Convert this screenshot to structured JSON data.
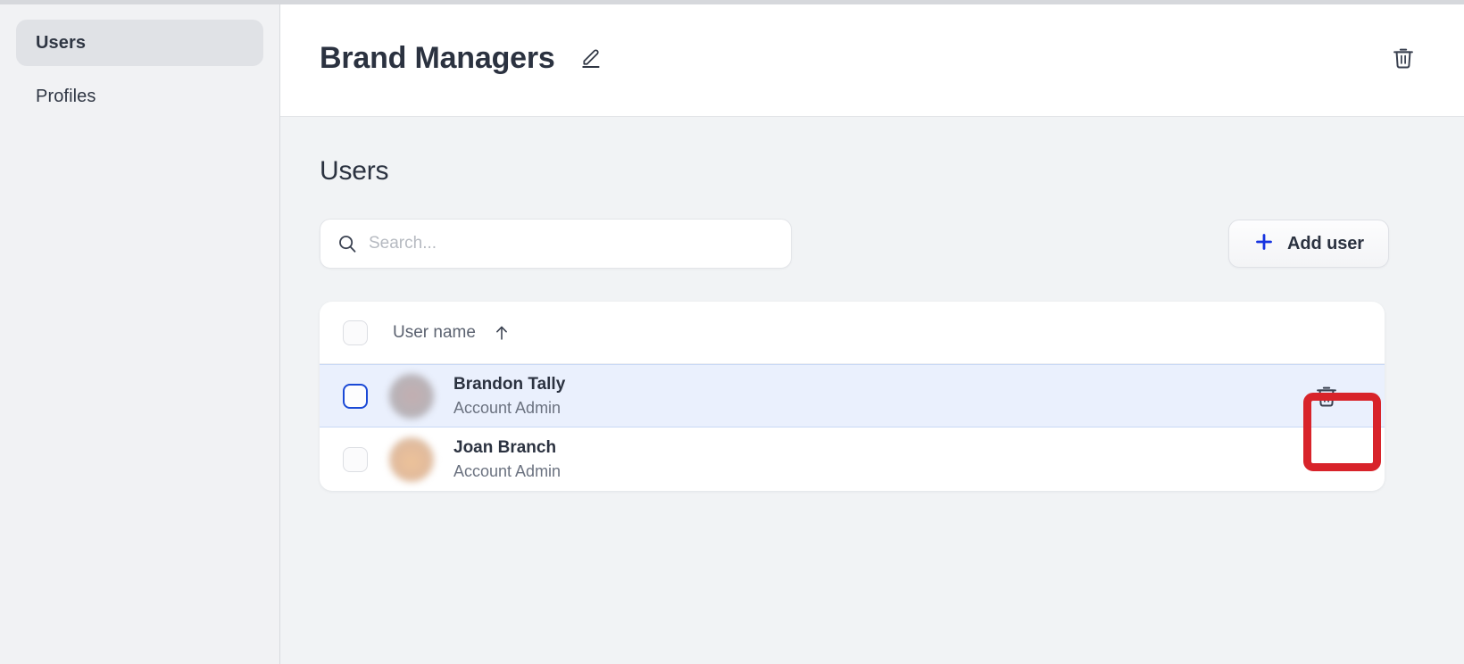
{
  "theme": {
    "accent_blue": "#1a49d6",
    "text_dark": "#2b3240",
    "text_muted": "#6b7280",
    "sidebar_bg": "#f1f2f4",
    "content_bg": "#f1f3f5",
    "selected_row_bg": "#eaf0fd",
    "annotation_red": "#d8232a"
  },
  "sidebar": {
    "items": [
      {
        "label": "Users",
        "active": true
      },
      {
        "label": "Profiles",
        "active": false
      }
    ]
  },
  "header": {
    "title": "Brand Managers",
    "edit_icon": "pencil-icon",
    "delete_icon": "trash-icon"
  },
  "main": {
    "section_title": "Users",
    "search": {
      "placeholder": "Search...",
      "value": "",
      "icon": "search-icon"
    },
    "add_user": {
      "label": "Add user",
      "icon": "plus-icon"
    },
    "table": {
      "columns": [
        {
          "label": "User name",
          "sort": "ascending",
          "sort_icon": "arrow-up-icon"
        }
      ],
      "select_all_checked": false,
      "rows": [
        {
          "name": "Brandon Tally",
          "role": "Account Admin",
          "checked": false,
          "selected": true,
          "avatar": "avatar-blurred-gray",
          "delete_icon": "trash-icon"
        },
        {
          "name": "Joan Branch",
          "role": "Account Admin",
          "checked": false,
          "selected": false,
          "avatar": "avatar-blurred-tan",
          "delete_icon": "trash-icon"
        }
      ]
    }
  },
  "annotation": {
    "type": "red-highlight-box",
    "target": "row-delete-button"
  }
}
